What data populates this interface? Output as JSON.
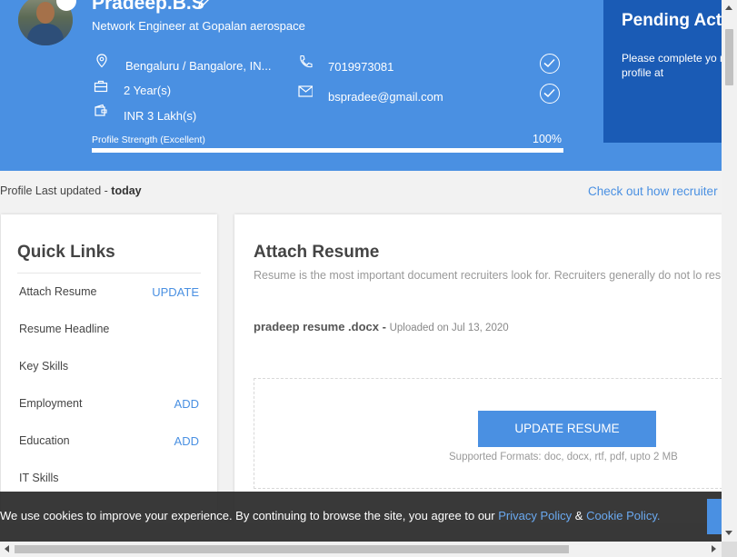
{
  "profile": {
    "name": "Pradeep.B.S",
    "role": "Network Engineer at Gopalan aerospace",
    "location": "Bengaluru / Bangalore, IN...",
    "experience": "2 Year(s)",
    "salary": "INR 3 Lakh(s)",
    "phone": "7019973081",
    "email": "bspradee@gmail.com",
    "strength_label": "Profile Strength (Excellent)",
    "strength_pct": "100%",
    "strength_value": 1.0
  },
  "pending": {
    "title": "Pending Act",
    "text": "Please complete yo make your profile at"
  },
  "status": {
    "updated_label": "Profile Last updated - ",
    "updated_value": "today",
    "checkout_link": "Check out how recruiter"
  },
  "quick_links": {
    "title": "Quick Links",
    "items": [
      {
        "label": "Attach Resume",
        "action": "UPDATE"
      },
      {
        "label": "Resume Headline",
        "action": ""
      },
      {
        "label": "Key Skills",
        "action": ""
      },
      {
        "label": "Employment",
        "action": "ADD"
      },
      {
        "label": "Education",
        "action": "ADD"
      },
      {
        "label": "IT Skills",
        "action": ""
      }
    ]
  },
  "resume": {
    "title": "Attach Resume",
    "description": "Resume is the most important document recruiters look for. Recruiters generally do not lo resumes.",
    "file_name": "pradeep resume .docx - ",
    "uploaded": "Uploaded on Jul 13, 2020",
    "button": "UPDATE RESUME",
    "formats": "Supported Formats: doc, docx, rtf, pdf, upto 2 MB"
  },
  "cookie": {
    "text": "We use cookies to improve your experience. By continuing to browse the site, you agree to our ",
    "privacy": "Privacy Policy",
    "amp": " & ",
    "cookie_policy": "Cookie Policy."
  },
  "colors": {
    "header": "#4a90e2",
    "pending": "#1a5bb5",
    "accent": "#4a90e2"
  }
}
